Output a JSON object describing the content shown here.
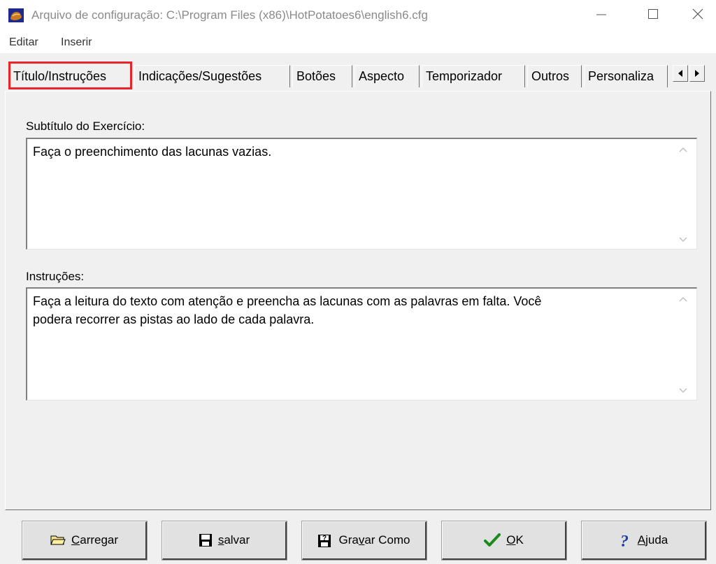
{
  "window": {
    "title": "Arquivo de configuração: C:\\Program Files (x86)\\HotPotatoes6\\english6.cfg"
  },
  "menu": {
    "edit": "Editar",
    "insert": "Inserir"
  },
  "tabs": [
    {
      "label": "Título/Instruções",
      "active": true
    },
    {
      "label": "Indicações/Sugestões"
    },
    {
      "label": "Botões"
    },
    {
      "label": "Aspecto"
    },
    {
      "label": "Temporizador"
    },
    {
      "label": "Outros"
    },
    {
      "label": "Personaliza"
    }
  ],
  "fields": {
    "subtitle_label": "Subtítulo do Exercício:",
    "subtitle_value": "Faça o preenchimento das lacunas vazias.",
    "instructions_label": "Instruções:",
    "instructions_value": "Faça a leitura do texto com atenção e preencha as lacunas com as palavras em falta. Você\npodera recorrer as pistas ao lado de cada palavra."
  },
  "buttons": {
    "load": {
      "mnemonic": "C",
      "rest": "arregar"
    },
    "save": {
      "mnemonic": "s",
      "rest": "alvar"
    },
    "save_as": {
      "before": "Gra",
      "mnemonic": "v",
      "after": "ar Como"
    },
    "ok": {
      "mnemonic": "O",
      "rest": "K"
    },
    "help": {
      "mnemonic": "A",
      "rest": "juda"
    }
  },
  "colors": {
    "highlight": "#e8232a",
    "ok_check": "#1a8a1a",
    "help_question": "#1e3ea8"
  }
}
